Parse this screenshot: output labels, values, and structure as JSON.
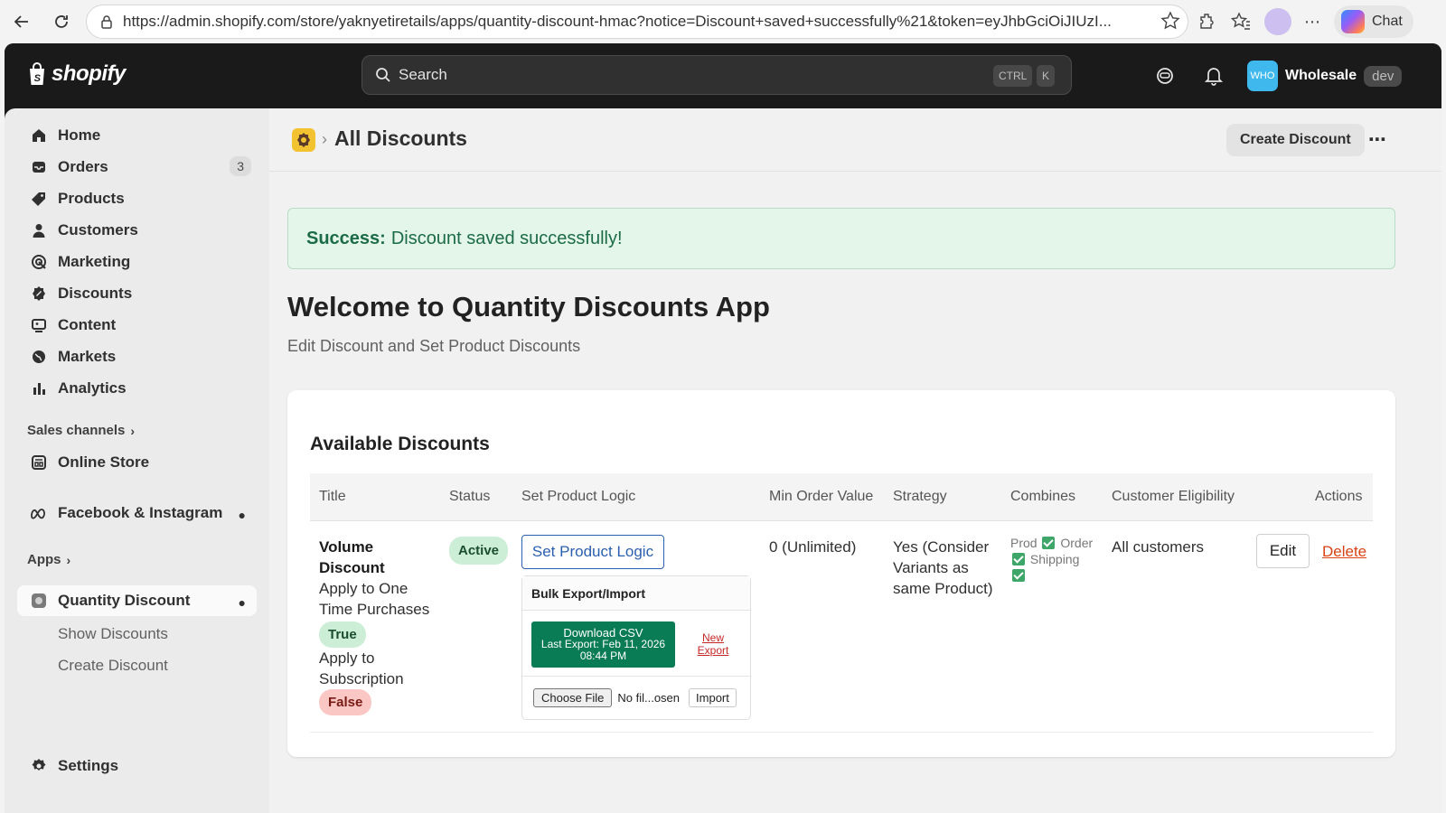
{
  "browser": {
    "url": "https://admin.shopify.com/store/yaknyetiretails/apps/quantity-discount-hmac?notice=Discount+saved+successfully%21&token=eyJhbGciOiJIUzI...",
    "chat_label": "Chat"
  },
  "topbar": {
    "logo_text": "shopify",
    "search_label": "Search",
    "kbd_ctrl": "CTRL",
    "kbd_k": "K",
    "store_avatar": "WHO",
    "store_name": "Wholesale",
    "store_badge": "dev"
  },
  "sidebar": {
    "items": [
      {
        "label": "Home",
        "icon": "home-icon"
      },
      {
        "label": "Orders",
        "icon": "inbox-icon",
        "count": "3"
      },
      {
        "label": "Products",
        "icon": "tag-icon"
      },
      {
        "label": "Customers",
        "icon": "person-icon"
      },
      {
        "label": "Marketing",
        "icon": "target-icon"
      },
      {
        "label": "Discounts",
        "icon": "discount-icon"
      },
      {
        "label": "Content",
        "icon": "content-icon"
      },
      {
        "label": "Markets",
        "icon": "globe-icon"
      },
      {
        "label": "Analytics",
        "icon": "bar-chart-icon"
      }
    ],
    "sales_channels_label": "Sales channels",
    "online_store_label": "Online Store",
    "facebook_label": "Facebook & Instagram",
    "apps_label": "Apps",
    "quantity_discount_label": "Quantity Discount",
    "sub_items": [
      "Show Discounts",
      "Create Discount"
    ],
    "settings_label": "Settings"
  },
  "header": {
    "title": "All Discounts",
    "create_button": "Create Discount"
  },
  "banner": {
    "prefix": "Success:",
    "message": "Discount saved successfully!"
  },
  "welcome": {
    "title": "Welcome to Quantity Discounts App",
    "subtitle": "Edit Discount and Set Product Discounts"
  },
  "table": {
    "title": "Available Discounts",
    "columns": [
      "Title",
      "Status",
      "Set Product Logic",
      "Min Order Value",
      "Strategy",
      "Combines",
      "Customer Eligibility",
      "Actions"
    ],
    "row": {
      "title": "Volume Discount",
      "one_time_label": "Apply to One Time Purchases",
      "one_time_value": "True",
      "subscription_label": "Apply to Subscription",
      "subscription_value": "False",
      "status": "Active",
      "set_logic_button": "Set Product Logic",
      "bulk_title": "Bulk Export/Import",
      "download_label": "Download CSV",
      "last_export": "Last Export: Feb 11, 2026 08:44 PM",
      "new_export": "New Export",
      "choose_file": "Choose File",
      "no_file": "No fil...osen",
      "import_label": "Import",
      "min_order": "0 (Unlimited)",
      "strategy": "Yes (Consider Variants as same Product)",
      "combines_prod": "Prod",
      "combines_order": "Order",
      "combines_shipping": "Shipping",
      "eligibility": "All customers",
      "edit_label": "Edit",
      "delete_label": "Delete"
    }
  }
}
